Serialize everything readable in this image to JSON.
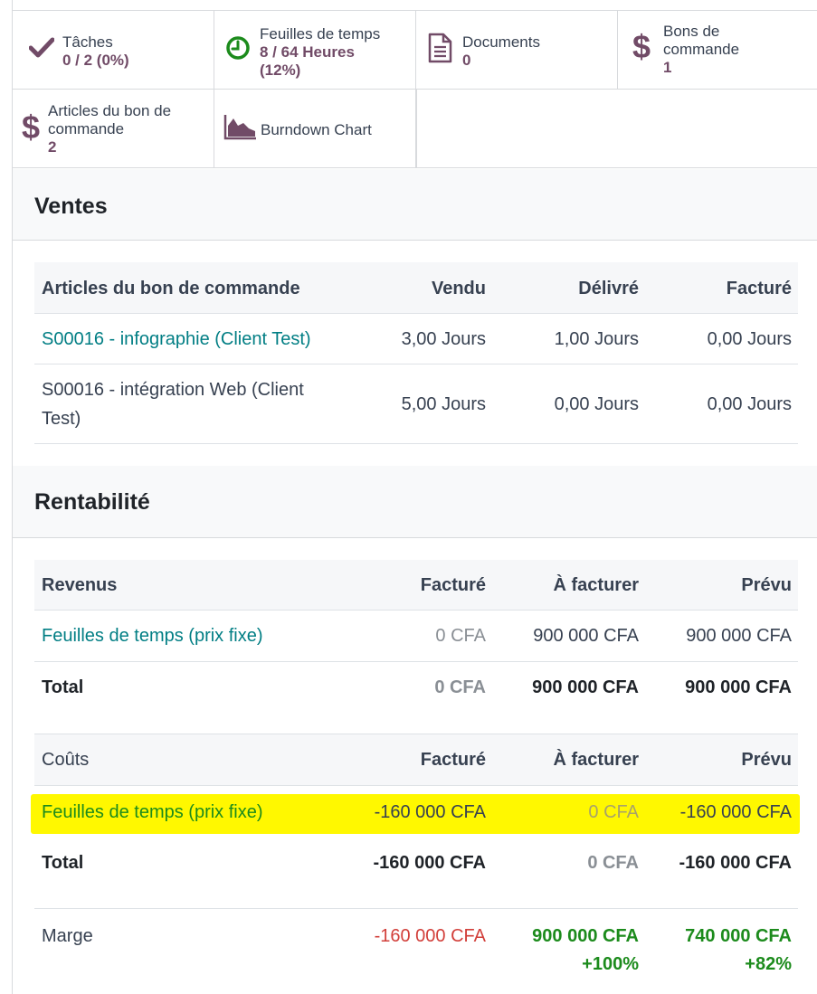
{
  "stats": {
    "tasks": {
      "label": "Tâches",
      "value": "0 / 2 (0%)"
    },
    "timesheets": {
      "label": "Feuilles de temps",
      "value": "8 / 64 Heures",
      "percent": "(12%)"
    },
    "documents": {
      "label": "Documents",
      "value": "0"
    },
    "purchase_orders": {
      "label1": "Bons de",
      "label2": "commande",
      "value": "1"
    },
    "po_lines": {
      "label1": "Articles du bon de",
      "label2": "commande",
      "value": "2"
    },
    "burndown": {
      "label": "Burndown Chart"
    }
  },
  "sales": {
    "title": "Ventes",
    "columns": [
      "Articles du bon de commande",
      "Vendu",
      "Délivré",
      "Facturé"
    ],
    "rows": [
      {
        "name": "S00016 - infographie (Client Test)",
        "sold": "3,00 Jours",
        "delivered": "1,00 Jours",
        "invoiced": "0,00 Jours"
      },
      {
        "name1": "S00016 - intégration Web (Client",
        "name2": "Test)",
        "sold": "5,00 Jours",
        "delivered": "0,00 Jours",
        "invoiced": "0,00 Jours"
      }
    ]
  },
  "profitability": {
    "title": "Rentabilité",
    "revenues": {
      "columns": [
        "Revenus",
        "Facturé",
        "À facturer",
        "Prévu"
      ],
      "row": {
        "name": "Feuilles de temps (prix fixe)",
        "invoiced": "0 CFA",
        "to_invoice": "900 000 CFA",
        "expected": "900 000 CFA"
      },
      "total": {
        "label": "Total",
        "invoiced": "0 CFA",
        "to_invoice": "900 000 CFA",
        "expected": "900 000 CFA"
      }
    },
    "costs": {
      "columns": [
        "Coûts",
        "Facturé",
        "À facturer",
        "Prévu"
      ],
      "row": {
        "name": "Feuilles de temps (prix fixe)",
        "invoiced": "-160 000 CFA",
        "to_invoice": "0 CFA",
        "expected": "-160 000 CFA"
      },
      "total": {
        "label": "Total",
        "invoiced": "-160 000 CFA",
        "to_invoice": "0 CFA",
        "expected": "-160 000 CFA"
      }
    },
    "margin": {
      "label": "Marge",
      "invoiced": "-160 000 CFA",
      "to_invoice": "900 000 CFA",
      "to_invoice_pct": "+100%",
      "expected": "740 000 CFA",
      "expected_pct": "+82%"
    }
  },
  "colors": {
    "accent": "#714B67",
    "link": "#017e84",
    "highlight": "#fff800",
    "negative": "#d23f3a",
    "positive": "#1c8b1c"
  }
}
